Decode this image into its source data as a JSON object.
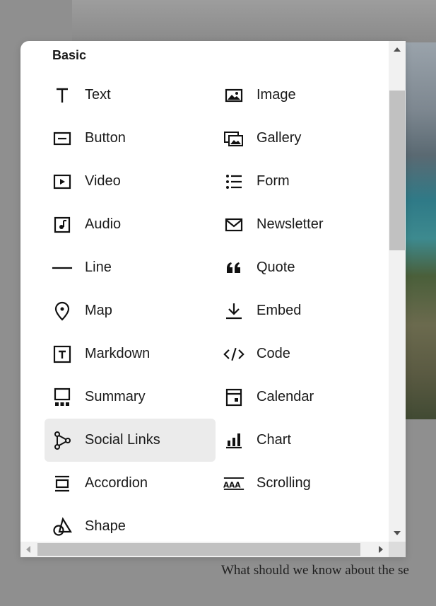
{
  "background": {
    "footer_text": "What should we know about the se"
  },
  "panel": {
    "section_title": "Basic",
    "items": [
      {
        "label": "Text",
        "icon": "text-icon"
      },
      {
        "label": "Image",
        "icon": "image-icon"
      },
      {
        "label": "Button",
        "icon": "button-icon"
      },
      {
        "label": "Gallery",
        "icon": "gallery-icon"
      },
      {
        "label": "Video",
        "icon": "video-icon"
      },
      {
        "label": "Form",
        "icon": "form-icon"
      },
      {
        "label": "Audio",
        "icon": "audio-icon"
      },
      {
        "label": "Newsletter",
        "icon": "newsletter-icon"
      },
      {
        "label": "Line",
        "icon": "line-icon"
      },
      {
        "label": "Quote",
        "icon": "quote-icon"
      },
      {
        "label": "Map",
        "icon": "map-pin-icon"
      },
      {
        "label": "Embed",
        "icon": "embed-icon"
      },
      {
        "label": "Markdown",
        "icon": "markdown-icon"
      },
      {
        "label": "Code",
        "icon": "code-icon"
      },
      {
        "label": "Summary",
        "icon": "summary-icon"
      },
      {
        "label": "Calendar",
        "icon": "calendar-icon"
      },
      {
        "label": "Social Links",
        "icon": "social-links-icon",
        "hovered": true
      },
      {
        "label": "Chart",
        "icon": "chart-icon"
      },
      {
        "label": "Accordion",
        "icon": "accordion-icon"
      },
      {
        "label": "Scrolling",
        "icon": "scrolling-icon"
      },
      {
        "label": "Shape",
        "icon": "shape-icon"
      }
    ]
  },
  "colors": {
    "overlay": "#8f8f8f",
    "panel": "#ffffff",
    "hover": "#ebebeb",
    "text": "#1a1a1a",
    "scroll_track": "#f1f1f1",
    "scroll_thumb": "#c1c1c1"
  }
}
